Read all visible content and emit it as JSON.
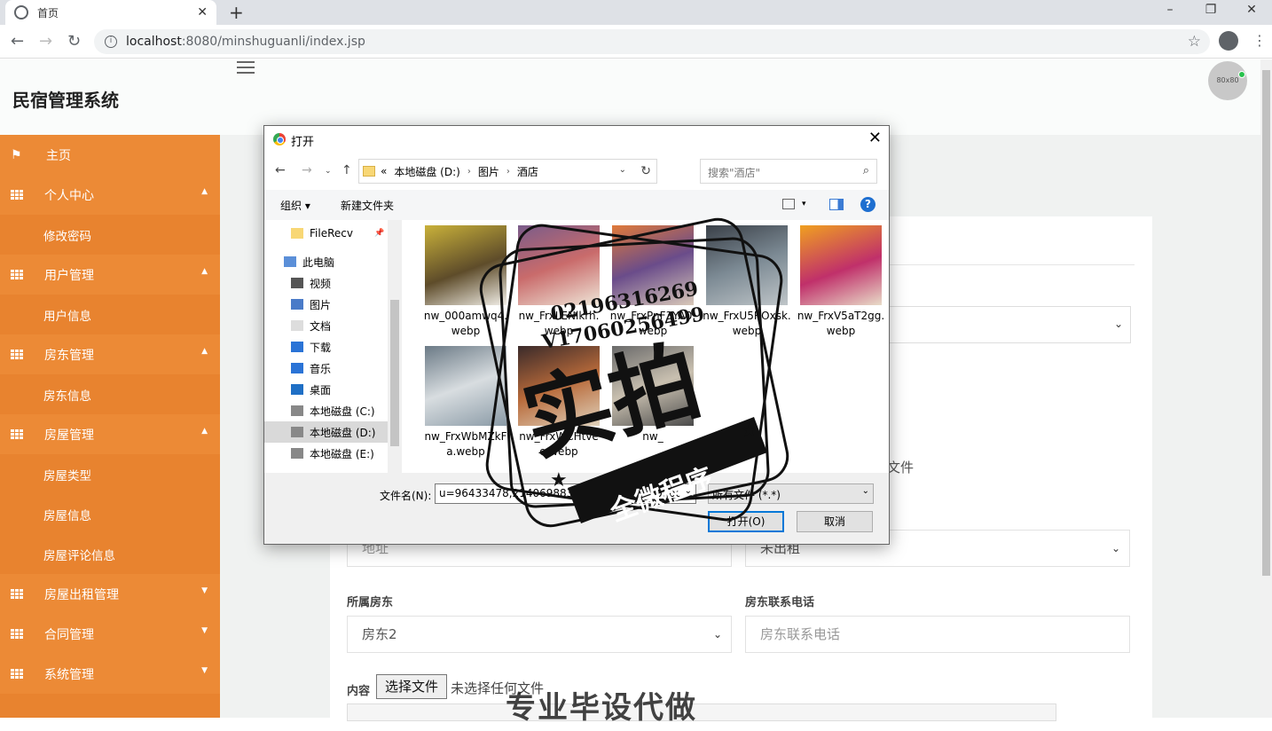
{
  "browser": {
    "tab_title": "首页",
    "url_host": "localhost",
    "url_rest": ":8080/minshuguanli/index.jsp",
    "icons": [
      "back-icon",
      "forward-icon",
      "reload-icon",
      "info-icon",
      "star-icon",
      "profile-icon",
      "menu-icon"
    ]
  },
  "app": {
    "title": "民宿管理系统",
    "avatar_text": "80x80"
  },
  "sidebar": {
    "items": [
      {
        "label": "主页",
        "type": "top",
        "icon": "flag-icon"
      },
      {
        "label": "个人中心",
        "type": "top",
        "icon": "grid-icon",
        "caret": "▲"
      },
      {
        "label": "修改密码",
        "type": "sub"
      },
      {
        "label": "用户管理",
        "type": "top",
        "icon": "grid-icon",
        "caret": "▲"
      },
      {
        "label": "用户信息",
        "type": "sub"
      },
      {
        "label": "房东管理",
        "type": "top",
        "icon": "grid-icon",
        "caret": "▲"
      },
      {
        "label": "房东信息",
        "type": "sub"
      },
      {
        "label": "房屋管理",
        "type": "top",
        "icon": "grid-icon",
        "caret": "▲"
      },
      {
        "label": "房屋类型",
        "type": "sub"
      },
      {
        "label": "房屋信息",
        "type": "sub"
      },
      {
        "label": "房屋评论信息",
        "type": "sub"
      },
      {
        "label": "房屋出租管理",
        "type": "top",
        "icon": "grid-icon",
        "caret": "▼"
      },
      {
        "label": "合同管理",
        "type": "top",
        "icon": "grid-icon",
        "caret": "▼"
      },
      {
        "label": "系统管理",
        "type": "top",
        "icon": "grid-icon",
        "caret": "▼"
      }
    ],
    "color": "#e8832f"
  },
  "form": {
    "file_fragment": "文件",
    "address_placeholder": "地址",
    "status_value": "未出租",
    "landlord_label": "所属房东",
    "landlord_value": "房东2",
    "phone_label": "房东联系电话",
    "phone_placeholder": "房东联系电话",
    "content_label": "内容",
    "file_button": "选择文件",
    "file_none": "未选择任何文件"
  },
  "dialog": {
    "title": "打开",
    "path": [
      "«",
      "本地磁盘 (D:)",
      "图片",
      "酒店"
    ],
    "search_placeholder": "搜索\"酒店\"",
    "organize": "组织 ▾",
    "new_folder": "新建文件夹",
    "help": "?",
    "tree": [
      {
        "label": "FileRecv",
        "icon": "folder-icon"
      },
      {
        "label": "此电脑",
        "icon": "computer-icon"
      },
      {
        "label": "视频",
        "icon": "video-icon"
      },
      {
        "label": "图片",
        "icon": "picture-icon"
      },
      {
        "label": "文档",
        "icon": "document-icon"
      },
      {
        "label": "下载",
        "icon": "download-icon"
      },
      {
        "label": "音乐",
        "icon": "music-icon"
      },
      {
        "label": "桌面",
        "icon": "desktop-icon"
      },
      {
        "label": "本地磁盘 (C:)",
        "icon": "drive-icon"
      },
      {
        "label": "本地磁盘 (D:)",
        "icon": "drive-icon",
        "selected": true
      },
      {
        "label": "本地磁盘 (E:)",
        "icon": "drive-icon"
      }
    ],
    "files": [
      {
        "name": "nw_000amwq4.webp"
      },
      {
        "name": "nw_FrxLENlkrh.webp"
      },
      {
        "name": "nw_FrxPnF3YA0.webp"
      },
      {
        "name": "nw_FrxU5ROxsk.webp"
      },
      {
        "name": "nw_FrxV5aT2gg.webp"
      },
      {
        "name": "nw_FrxWbMZkFa.webp"
      },
      {
        "name": "nw_FrxWCHtveo.webp"
      },
      {
        "name": "nw_"
      }
    ],
    "filename_label": "文件名(N):",
    "filename_value": "u=96433478,2140698832&fm=15&gp=0.jpg",
    "filetype_value": "所有文件 (*.*)",
    "open_button": "打开(O)",
    "cancel_button": "取消"
  },
  "watermark": {
    "big": "实拍",
    "banner": "全微程序",
    "numbers": [
      "02196316269",
      "V17060256499"
    ],
    "bottom": "专业毕设代做"
  }
}
